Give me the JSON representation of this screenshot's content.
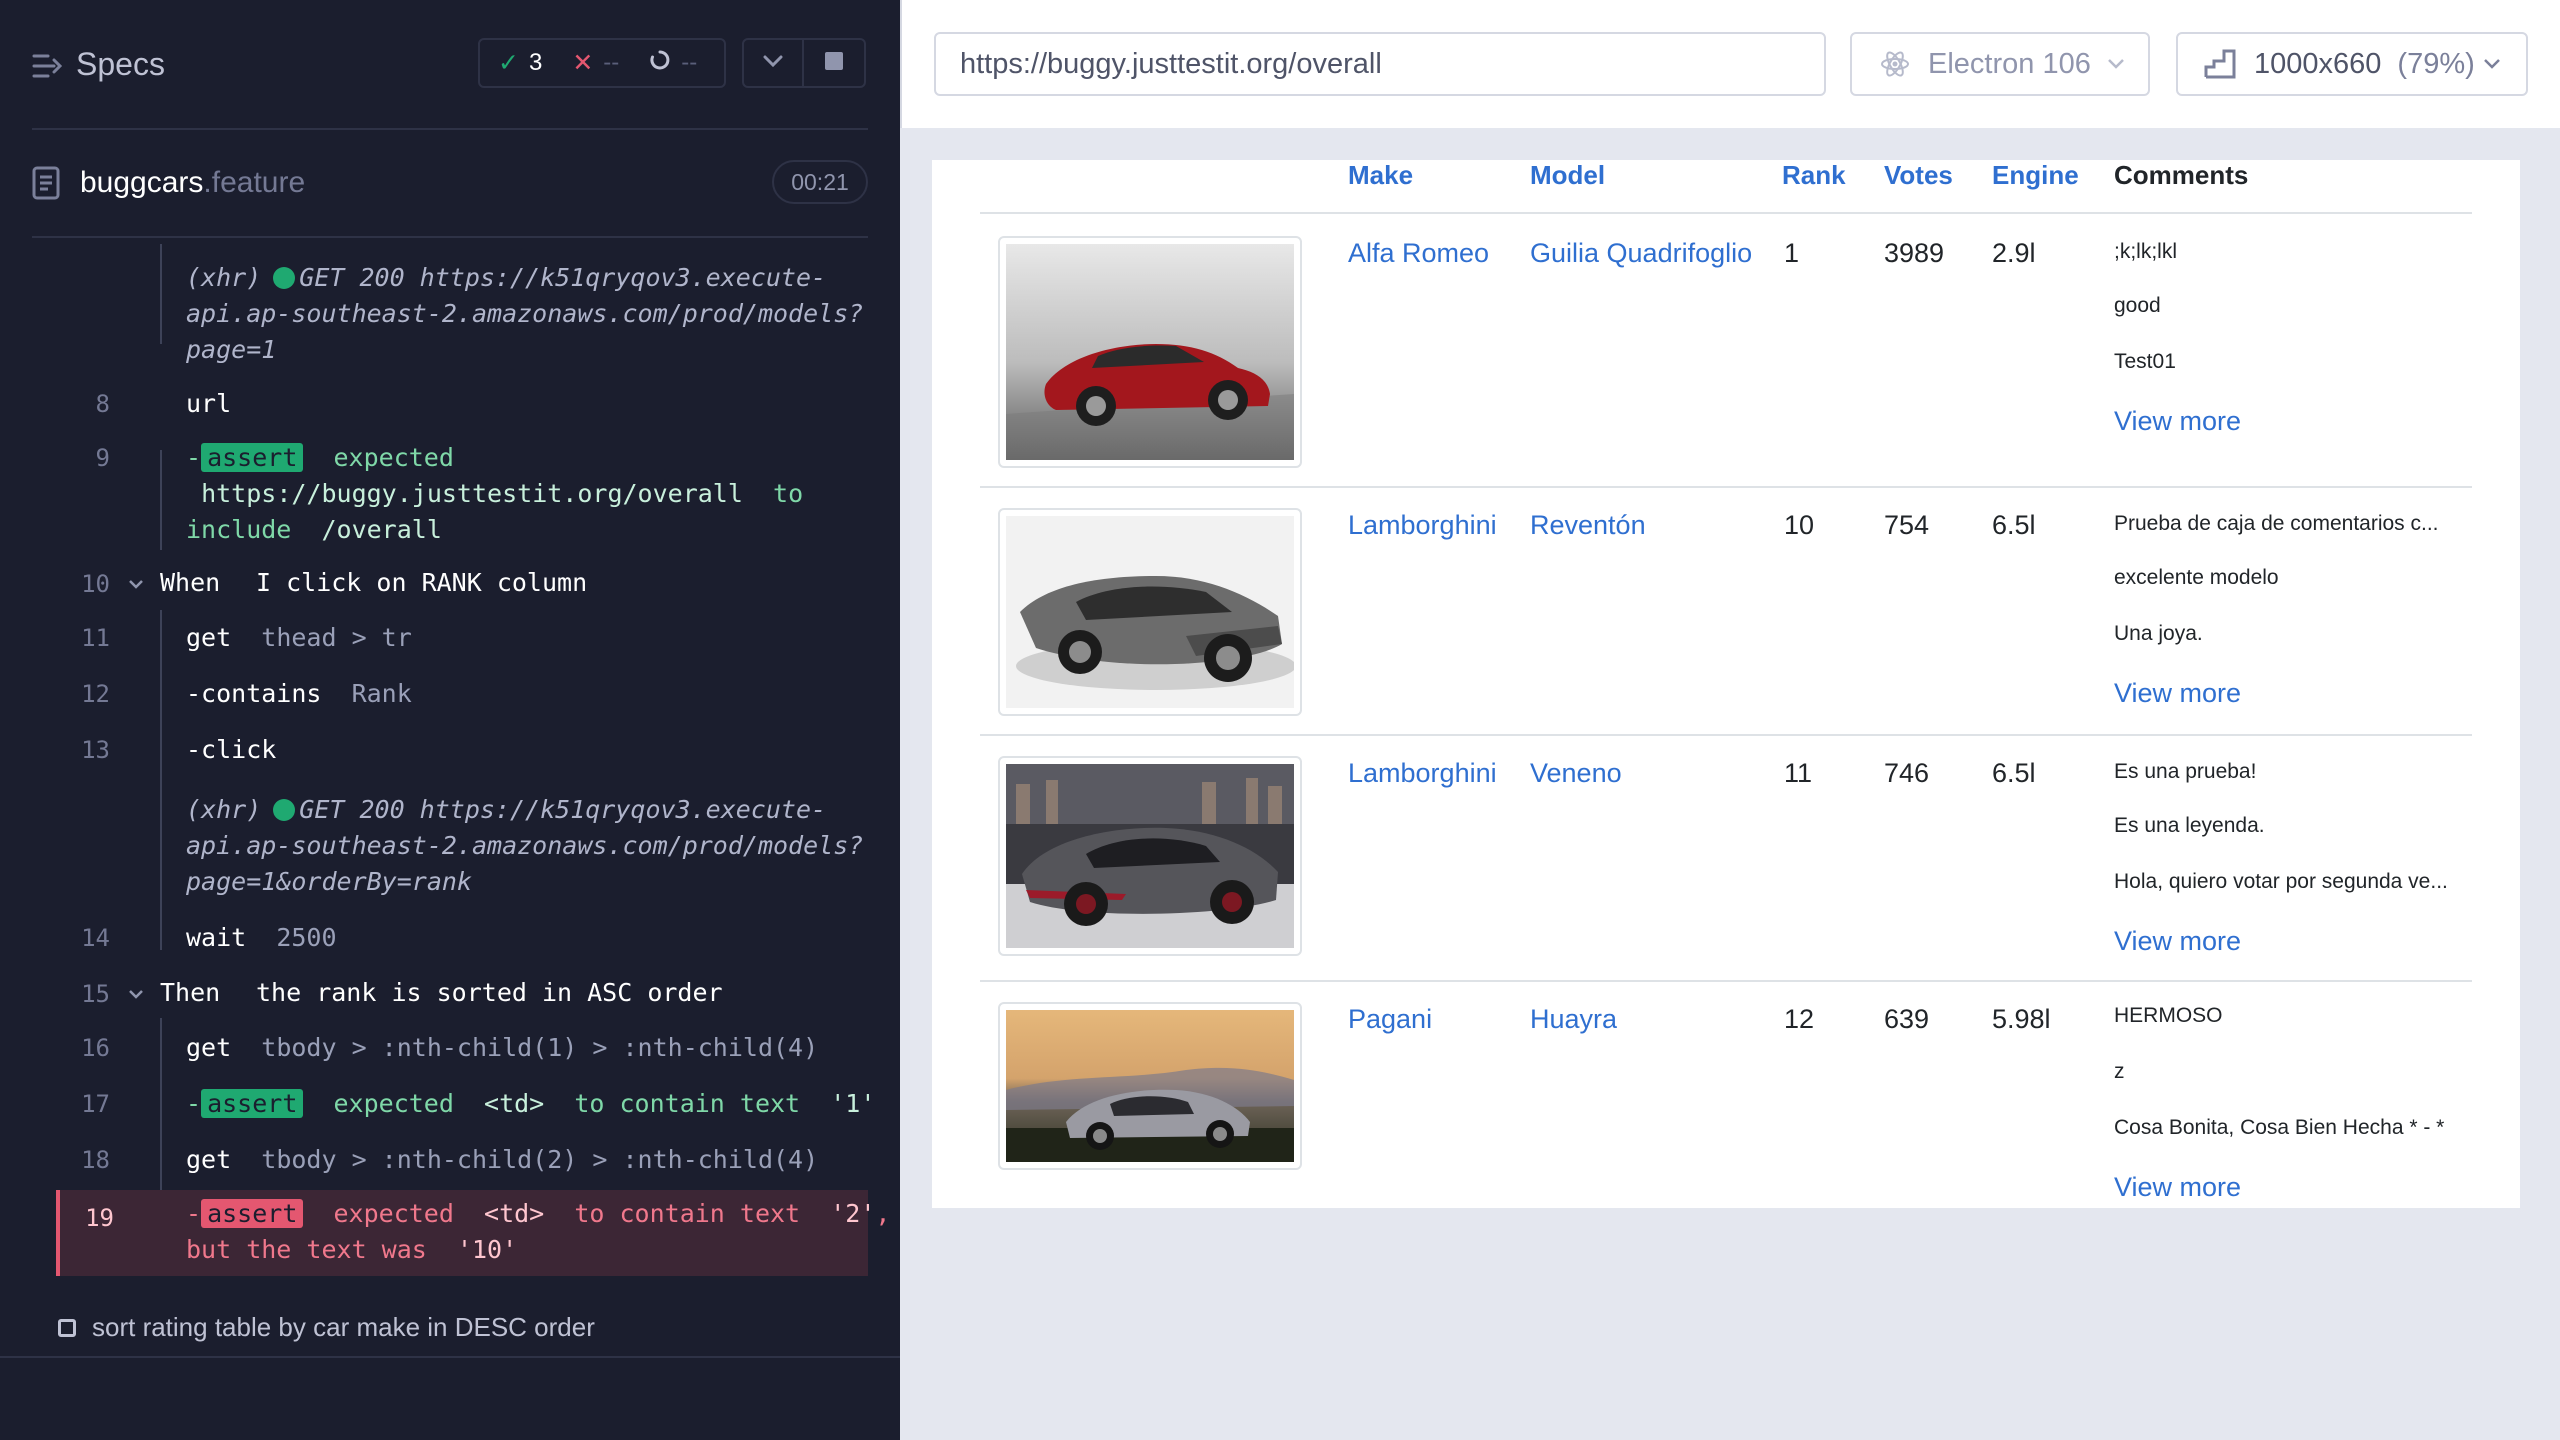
{
  "runner": {
    "title": "Specs",
    "stats": {
      "passed": "3",
      "failed": "--",
      "pending": "--"
    },
    "spec_file": {
      "name": "buggcars",
      "ext": ".feature",
      "duration": "00:21"
    },
    "xhr1": {
      "prefix": "(xhr)",
      "request": "GET 200 https://k51qryqov3.execute-\napi.ap-southeast-2.amazonaws.com/prod/models?\npage=1"
    },
    "line8": {
      "num": "8",
      "cmd": "url"
    },
    "line9": {
      "num": "9",
      "dash": "-",
      "tag": "assert",
      "w1": "expected",
      "url": "https://buggy.justtestit.org/overall",
      "w2": "to",
      "w3": "include",
      "val": "/overall"
    },
    "line10": {
      "num": "10",
      "keyword": "When",
      "text": "I click on RANK column"
    },
    "line11": {
      "num": "11",
      "cmd": "get",
      "arg": "thead > tr"
    },
    "line12": {
      "num": "12",
      "cmd": "-contains",
      "arg": "Rank"
    },
    "line13": {
      "num": "13",
      "cmd": "-click"
    },
    "xhr2": {
      "prefix": "(xhr)",
      "request": "GET 200 https://k51qryqov3.execute-\napi.ap-southeast-2.amazonaws.com/prod/models?\npage=1&orderBy=rank"
    },
    "line14": {
      "num": "14",
      "cmd": "wait",
      "arg": "2500"
    },
    "line15": {
      "num": "15",
      "keyword": "Then",
      "text": "the rank is sorted in ASC order"
    },
    "line16": {
      "num": "16",
      "cmd": "get",
      "arg": "tbody > :nth-child(1) > :nth-child(4)"
    },
    "line17": {
      "num": "17",
      "dash": "-",
      "tag": "assert",
      "w1": "expected",
      "el": "<td>",
      "w2": "to contain text",
      "val": "'1'"
    },
    "line18": {
      "num": "18",
      "cmd": "get",
      "arg": "tbody > :nth-child(2) > :nth-child(4)"
    },
    "line19": {
      "num": "19",
      "dash": "-",
      "tag": "assert",
      "w1": "expected",
      "el": "<td>",
      "w2": "to contain text",
      "val": "'2'",
      "comma": ",",
      "w3": "but the text was",
      "actual": "'10'"
    },
    "next_test": "sort rating table by car make in DESC order"
  },
  "aut": {
    "url": "https://buggy.justtestit.org/overall",
    "browser": "Electron 106",
    "viewport": "1000x660",
    "zoom": "(79%)"
  },
  "table": {
    "headers": [
      "Make",
      "Model",
      "Rank",
      "Votes",
      "Engine",
      "Comments"
    ],
    "rows": [
      {
        "make": "Alfa Romeo",
        "model": "Guilia Quadrifoglio",
        "rank": "1",
        "votes": "3989",
        "engine": "2.9l",
        "comments": [
          ";k;lk;lkl",
          "good",
          "Test01"
        ],
        "view_more": "View more"
      },
      {
        "make": "Lamborghini",
        "model": "Reventón",
        "rank": "10",
        "votes": "754",
        "engine": "6.5l",
        "comments": [
          "Prueba de caja de comentarios c...",
          "excelente modelo",
          "Una joya."
        ],
        "view_more": "View more"
      },
      {
        "make": "Lamborghini",
        "model": "Veneno",
        "rank": "11",
        "votes": "746",
        "engine": "6.5l",
        "comments": [
          "Es una prueba!",
          "Es una leyenda.",
          "Hola, quiero votar por segunda ve..."
        ],
        "view_more": "View more"
      },
      {
        "make": "Pagani",
        "model": "Huayra",
        "rank": "12",
        "votes": "639",
        "engine": "5.98l",
        "comments": [
          "HERMOSO",
          "z",
          "Cosa Bonita, Cosa Bien Hecha * - *"
        ],
        "view_more": "View more"
      }
    ]
  },
  "colors": {
    "runner_bg": "#1b1e2e",
    "pass": "#1fa971",
    "fail": "#e45770",
    "link": "#2f6fd0"
  }
}
